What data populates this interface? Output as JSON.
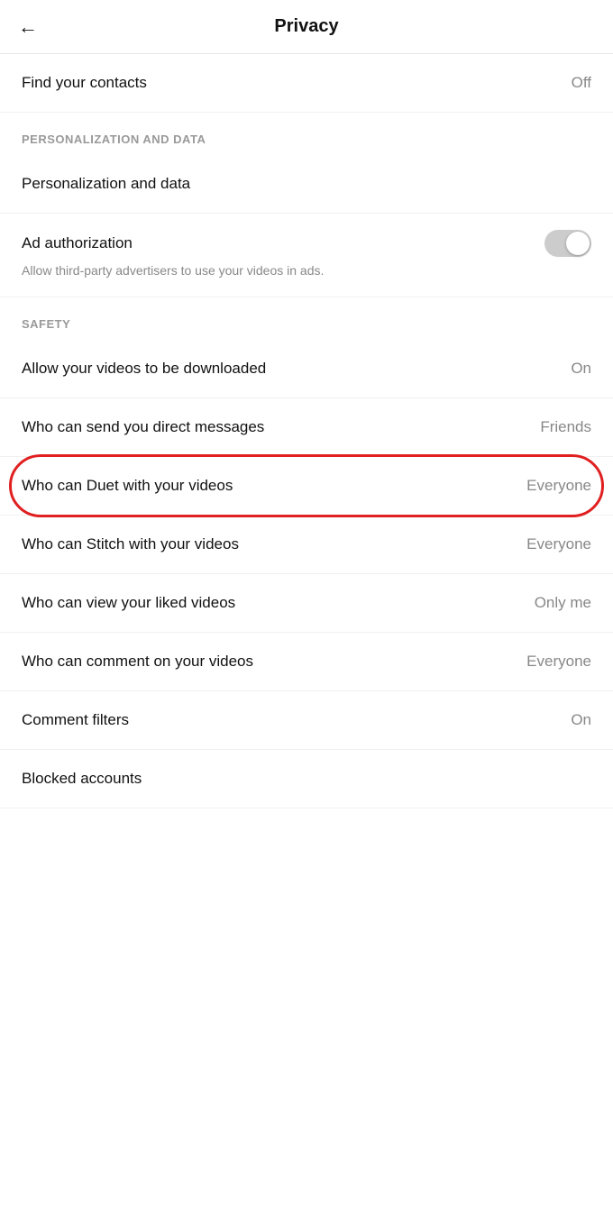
{
  "header": {
    "title": "Privacy",
    "back_label": "←"
  },
  "rows": {
    "find_contacts": {
      "label": "Find your contacts",
      "value": "Off"
    },
    "sections": {
      "personalization_header": "PERSONALIZATION AND DATA",
      "personalization_label": "Personalization and data",
      "ad_authorization_label": "Ad authorization",
      "ad_authorization_desc": "Allow third-party advertisers to use your videos in ads.",
      "safety_header": "SAFETY",
      "allow_downloads_label": "Allow your videos to be downloaded",
      "allow_downloads_value": "On",
      "direct_messages_label": "Who can send you direct messages",
      "direct_messages_value": "Friends",
      "duet_label": "Who can Duet with your videos",
      "duet_value": "Everyone",
      "stitch_label": "Who can Stitch with your videos",
      "stitch_value": "Everyone",
      "liked_videos_label": "Who can view your liked videos",
      "liked_videos_value": "Only me",
      "comment_label": "Who can comment on your videos",
      "comment_value": "Everyone",
      "comment_filters_label": "Comment filters",
      "comment_filters_value": "On",
      "blocked_accounts_label": "Blocked accounts"
    }
  }
}
